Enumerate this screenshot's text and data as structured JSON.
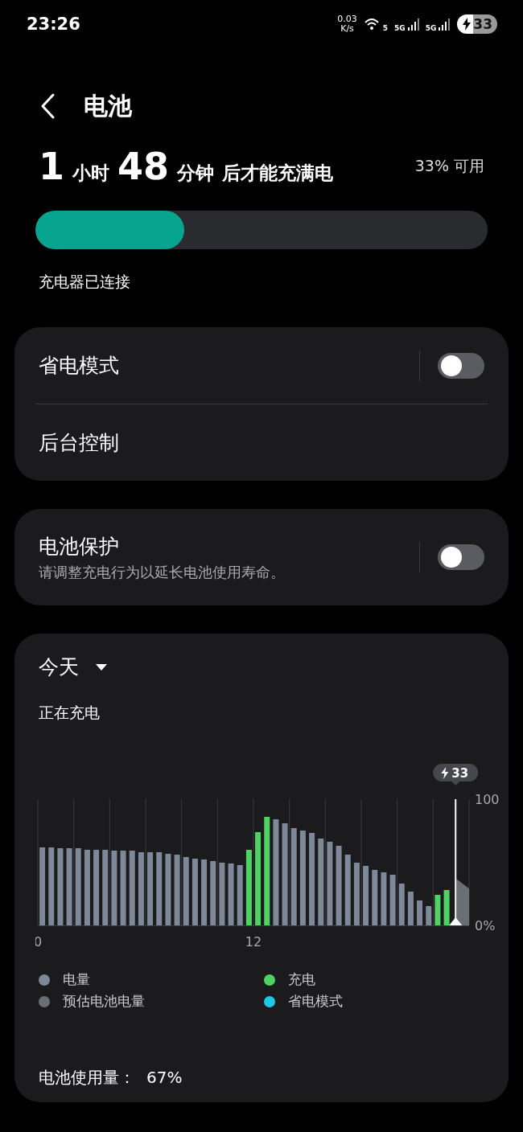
{
  "status_bar": {
    "time": "23:26",
    "net_speed": "0.03",
    "net_unit": "K/s",
    "wifi_label": "5",
    "signals": [
      "5G",
      "5G"
    ],
    "battery": "33"
  },
  "header": {
    "title": "电池"
  },
  "summary": {
    "headline": [
      {
        "text": "1",
        "kind": "number"
      },
      {
        "text": "小时",
        "kind": "unit"
      },
      {
        "text": "48",
        "kind": "number"
      },
      {
        "text": "分钟",
        "kind": "unit"
      },
      {
        "text": "后才能充满电",
        "kind": "unit"
      }
    ],
    "available": "33% 可用",
    "level": 0.33,
    "status": "充电器已连接"
  },
  "settings": [
    {
      "label": "省电模式",
      "on": false
    },
    {
      "label": "后台控制"
    }
  ],
  "protection": {
    "label": "电池保护",
    "description": "请调整充电行为以延长电池使用寿命。",
    "on": false
  },
  "usage": {
    "period": "今天",
    "state": "正在充电",
    "chart_data": {
      "type": "bar",
      "x": [
        0.25,
        0.75,
        1.25,
        1.75,
        2.25,
        2.75,
        3.25,
        3.75,
        4.25,
        4.75,
        5.25,
        5.75,
        6.25,
        6.75,
        7.25,
        7.75,
        8.25,
        8.75,
        9.25,
        9.75,
        10.25,
        10.75,
        11.25,
        11.75,
        12.25,
        12.75,
        13.25,
        13.75,
        14.25,
        14.75,
        15.25,
        15.75,
        16.25,
        16.75,
        17.25,
        17.75,
        18.25,
        18.75,
        19.25,
        19.75,
        20.25,
        20.75,
        21.25,
        21.75,
        22.25,
        22.75
      ],
      "ylim": [
        0,
        100
      ],
      "yticks": [
        {
          "value": 0,
          "label": "0%"
        },
        {
          "value": 100,
          "label": "100"
        }
      ],
      "xlim": [
        0,
        24
      ],
      "xticks": [
        {
          "value": 0,
          "label": "0"
        },
        {
          "value": 12,
          "label": "12"
        }
      ],
      "series": [
        {
          "name": "电量",
          "color": "#7d8899",
          "values": [
            62,
            62,
            61,
            61,
            61,
            60,
            60,
            60,
            59,
            59,
            59,
            58,
            58,
            58,
            57,
            56,
            54,
            53,
            52,
            51,
            50,
            49,
            48,
            null,
            null,
            null,
            84,
            81,
            77,
            75,
            73,
            69,
            66,
            63,
            56,
            50,
            47,
            44,
            42,
            40,
            33,
            27,
            20,
            15,
            null,
            null
          ]
        },
        {
          "name": "充电",
          "color": "#4fd164",
          "values": [
            null,
            null,
            null,
            null,
            null,
            null,
            null,
            null,
            null,
            null,
            null,
            null,
            null,
            null,
            null,
            null,
            null,
            null,
            null,
            null,
            null,
            null,
            null,
            60,
            74,
            86,
            null,
            null,
            null,
            null,
            null,
            null,
            null,
            null,
            null,
            null,
            null,
            null,
            null,
            null,
            null,
            null,
            null,
            null,
            24,
            28
          ]
        }
      ],
      "annotations": [
        "33"
      ]
    },
    "legend_extra": [
      {
        "label": "预估电池电量",
        "color": "#6a6e75"
      },
      {
        "label": "省电模式",
        "color": "#1ec8e6"
      }
    ],
    "total_label": "电池使用量：",
    "total_value": "67%"
  }
}
